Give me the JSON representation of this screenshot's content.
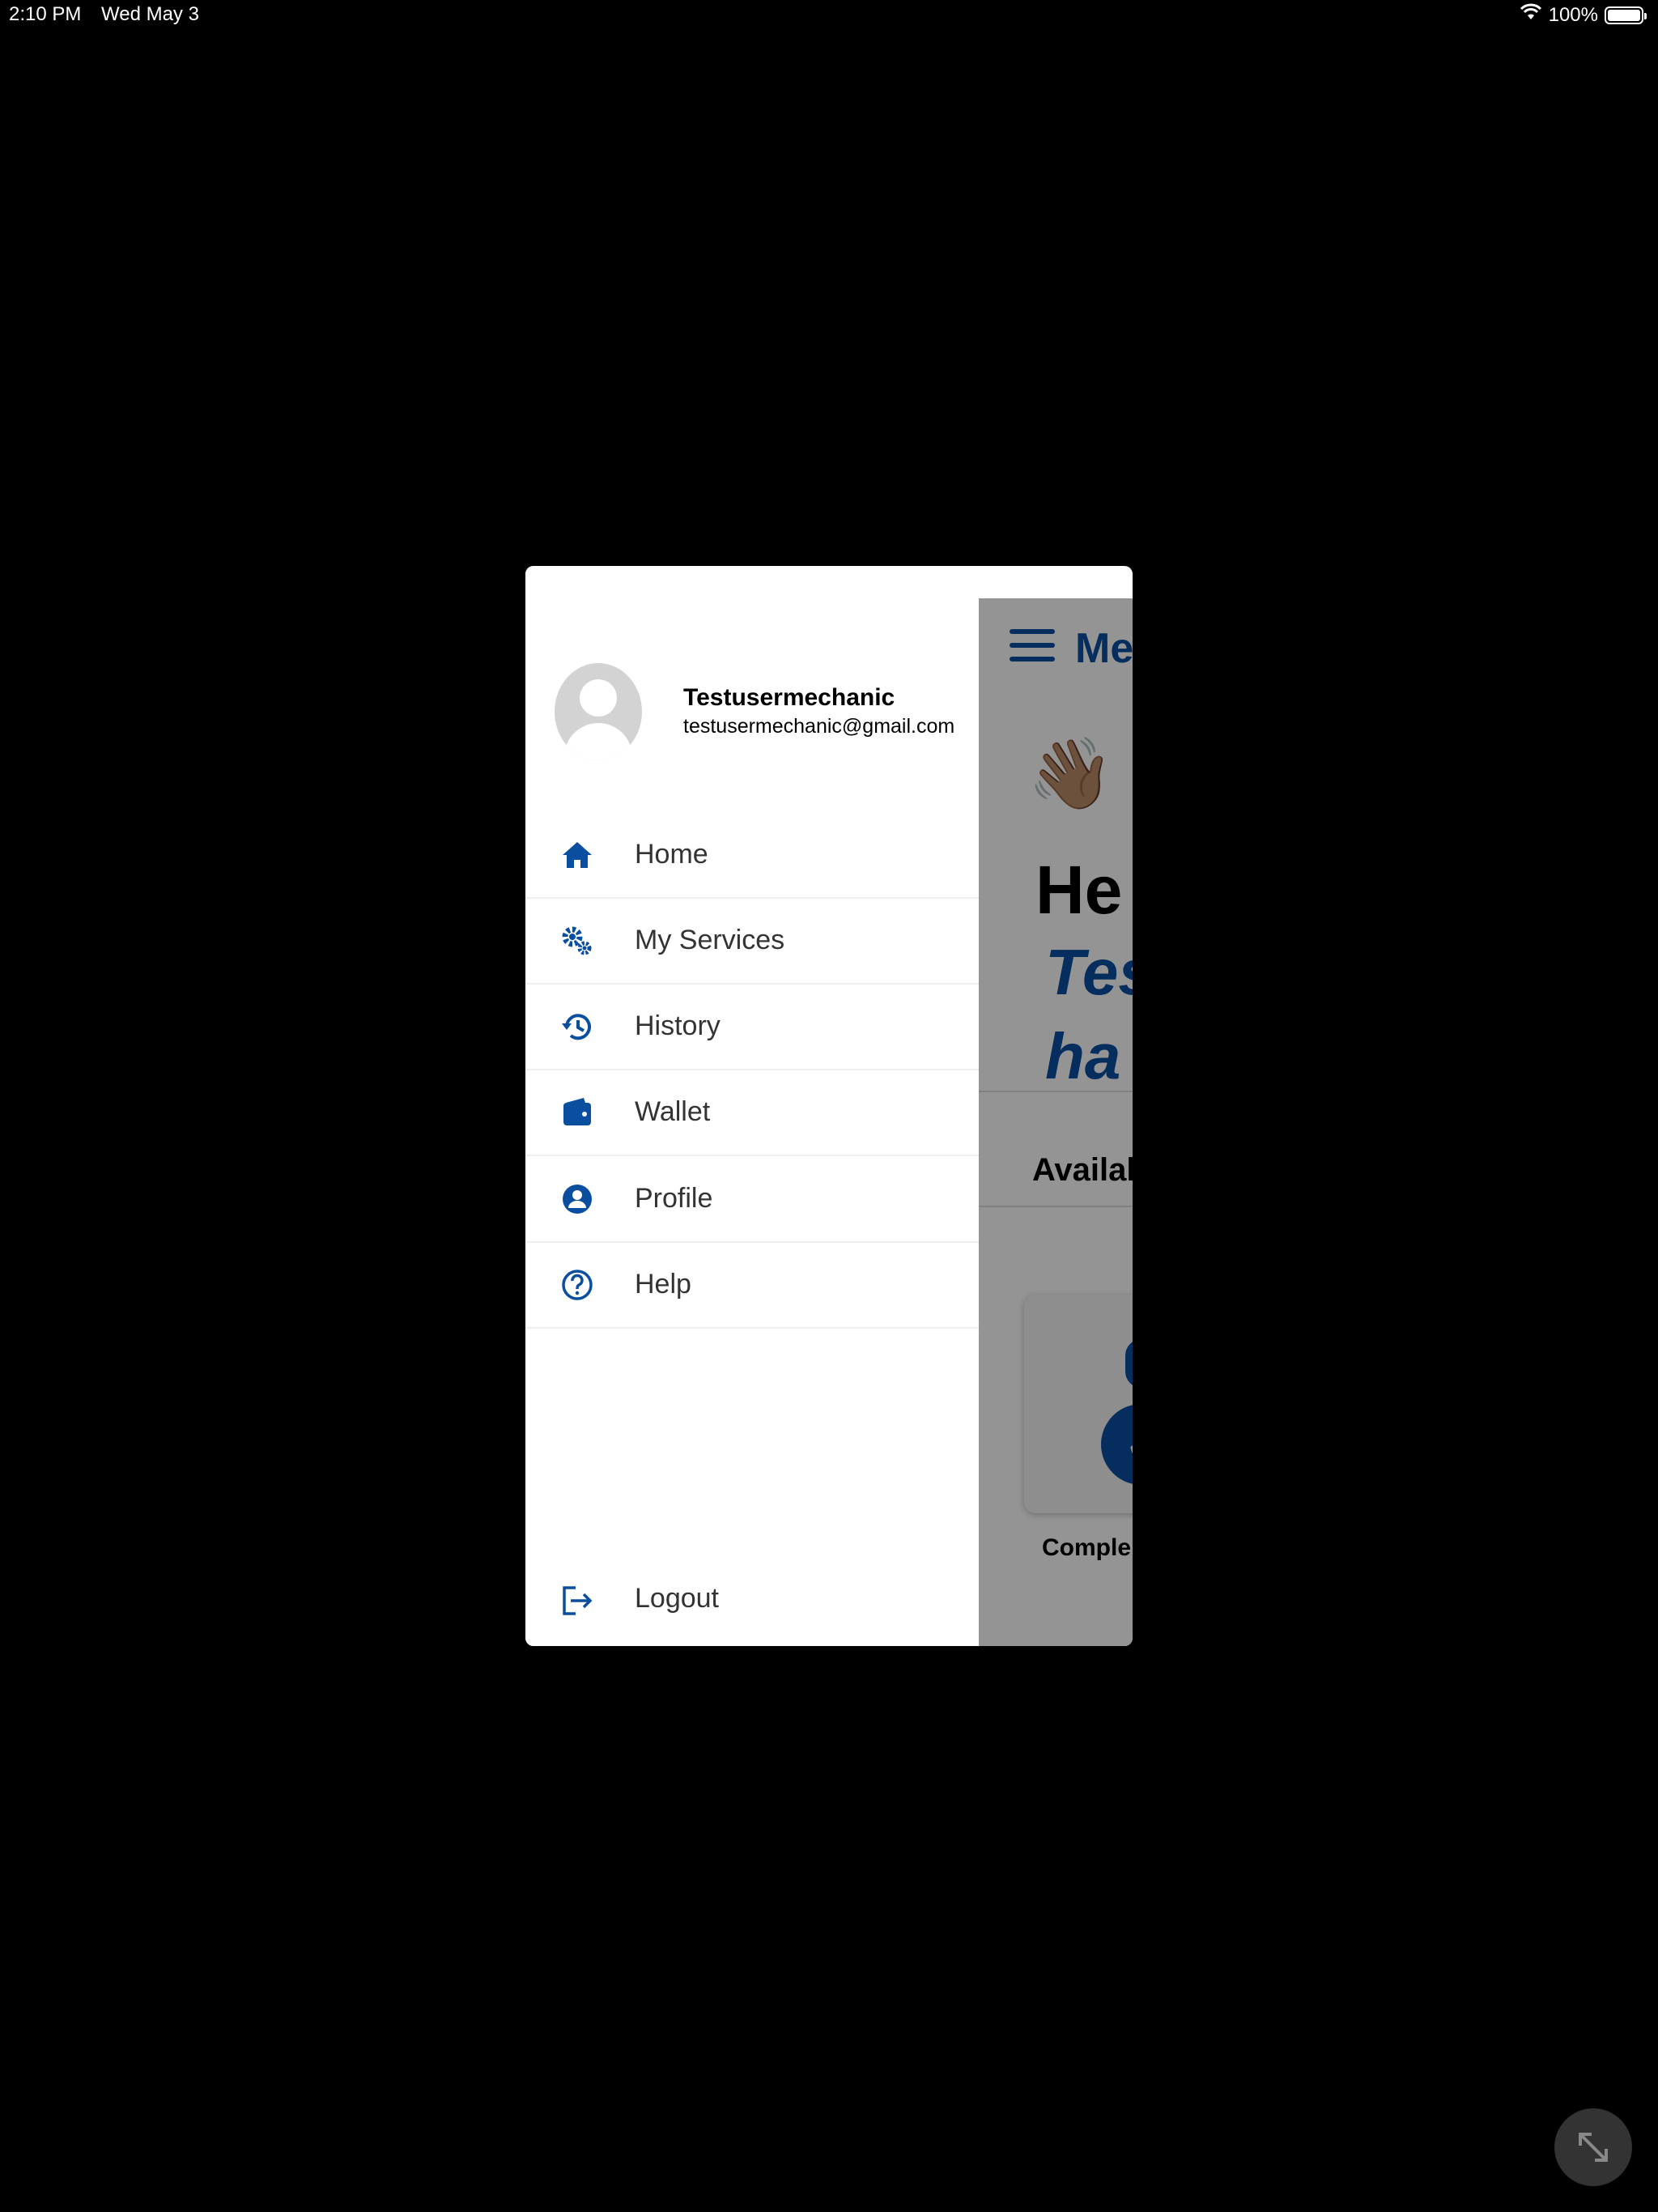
{
  "status_bar": {
    "time": "2:10 PM",
    "date": "Wed May 3",
    "battery_text": "100%",
    "battery_level": 1.0
  },
  "background_app": {
    "header_text": "Me",
    "wave_emoji": "👋🏽",
    "greeting": "He",
    "name_line1": "Tes",
    "name_line2": "ha",
    "available_label": "Availal",
    "completed_label": "Comple"
  },
  "drawer": {
    "user": {
      "name": "Testusermechanic",
      "email": "testusermechanic@gmail.com"
    },
    "menu": [
      {
        "label": "Home",
        "icon": "home-icon"
      },
      {
        "label": "My Services",
        "icon": "gears-icon"
      },
      {
        "label": "History",
        "icon": "history-icon"
      },
      {
        "label": "Wallet",
        "icon": "wallet-icon"
      },
      {
        "label": "Profile",
        "icon": "user-circle-icon"
      },
      {
        "label": "Help",
        "icon": "help-circle-icon"
      }
    ],
    "logout": {
      "label": "Logout",
      "icon": "logout-icon"
    }
  },
  "colors": {
    "accent": "#0a4ea0",
    "background": "#000000",
    "drawer": "#ffffff"
  }
}
